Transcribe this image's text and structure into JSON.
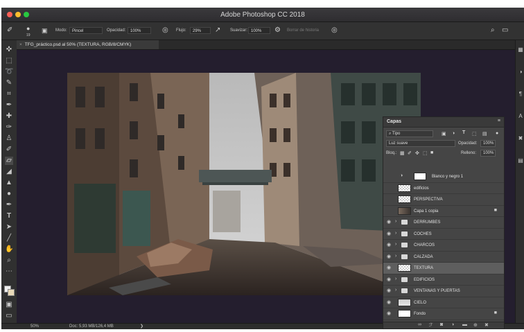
{
  "app": {
    "title": "Adobe Photoshop CC 2018"
  },
  "options_bar": {
    "brush_size": "19",
    "mode_label": "Modo:",
    "mode_value": "Pincel",
    "opacity_label": "Opacidad:",
    "opacity_value": "100%",
    "flow_label": "Flujo:",
    "flow_value": "29%",
    "smooth_label": "Suavizar:",
    "smooth_value": "100%",
    "history_label": "Borrar de historia"
  },
  "document": {
    "tab_title": "TFG_práctico.psd al 50% (TEXTURA, RGB/8/CMYK)"
  },
  "status": {
    "zoom": "50%",
    "doc_info": "Doc: 5,93 MB/126,4 MB"
  },
  "layers_panel": {
    "title": "Capas",
    "filter_kind": "Tipo",
    "blend_mode": "Luz suave",
    "opacity_label": "Opacidad:",
    "opacity_value": "100%",
    "lock_label": "Bloq.:",
    "fill_label": "Relleno:",
    "fill_value": "100%",
    "layers": [
      {
        "name": "Blanco y negro 1",
        "type": "adjustment",
        "visible": false
      },
      {
        "name": "edificios",
        "type": "pixel",
        "visible": false
      },
      {
        "name": "PERSPECTIVA",
        "type": "pixel",
        "visible": false
      },
      {
        "name": "Capa 1 copia",
        "type": "pixel",
        "visible": false,
        "locked": true
      },
      {
        "name": "DERRUMBES",
        "type": "group",
        "visible": true
      },
      {
        "name": "COCHES",
        "type": "group",
        "visible": true
      },
      {
        "name": "CHARCOS",
        "type": "group",
        "visible": true
      },
      {
        "name": "CALZADA",
        "type": "group",
        "visible": true
      },
      {
        "name": "TEXTURA",
        "type": "pixel",
        "visible": true,
        "active": true
      },
      {
        "name": "EDIFICIOS",
        "type": "group",
        "visible": true
      },
      {
        "name": "VENTANAS Y PUERTAS",
        "type": "group",
        "visible": true
      },
      {
        "name": "CIELO",
        "type": "pixel",
        "visible": true
      },
      {
        "name": "Fondo",
        "type": "pixel",
        "visible": true,
        "locked": true
      }
    ]
  },
  "icons": {
    "tools": [
      "move-icon",
      "marquee-icon",
      "lasso-icon",
      "quick-select-icon",
      "crop-icon",
      "eyedropper-icon",
      "healing-icon",
      "brush-icon",
      "stamp-icon",
      "history-brush-icon",
      "eraser-icon",
      "bucket-icon",
      "blur-icon",
      "dodge-icon",
      "pen-icon",
      "type-icon",
      "path-select-icon",
      "shape-icon",
      "hand-icon",
      "zoom-icon",
      "more-icon"
    ]
  }
}
